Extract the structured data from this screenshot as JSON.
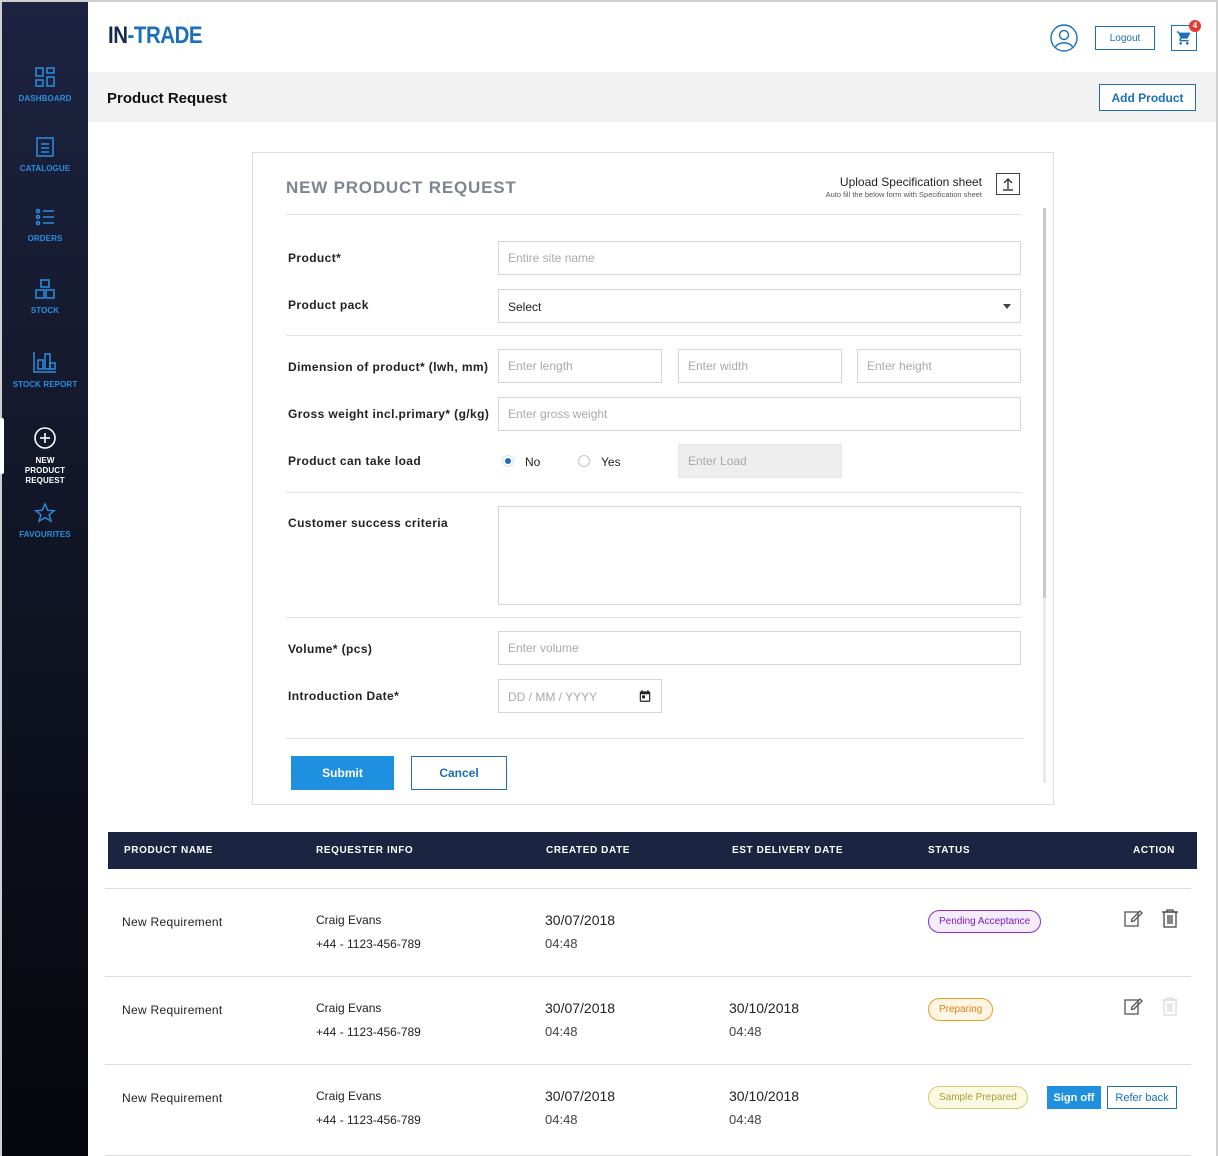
{
  "brand": {
    "logo_part1": "IN",
    "logo_part2": "-TRADE"
  },
  "sidebar": {
    "items": [
      {
        "label": "DASHBOARD",
        "icon": "dashboard-icon"
      },
      {
        "label": "CATALOGUE",
        "icon": "catalogue-icon"
      },
      {
        "label": "ORDERS",
        "icon": "orders-icon"
      },
      {
        "label": "STOCK",
        "icon": "stock-icon"
      },
      {
        "label": "STOCK REPORT",
        "icon": "stock-report-icon"
      },
      {
        "label": "NEW PRODUCT REQUEST",
        "icon": "plus-circle-icon",
        "active": true
      },
      {
        "label": "FAVOURITES",
        "icon": "star-icon"
      }
    ]
  },
  "header": {
    "logout_label": "Logout",
    "cart_count": "4"
  },
  "subheader": {
    "page_title": "Product Request",
    "add_product_label": "Add Product"
  },
  "form": {
    "title": "NEW PRODUCT REQUEST",
    "upload_label": "Upload Specification sheet",
    "upload_sub": "Auto fill the below form with Specification sheet",
    "product_label": "Product*",
    "product_placeholder": "Entire site name",
    "pack_label": "Product pack",
    "pack_value": "Select",
    "dimension_label": "Dimension of product* (lwh, mm)",
    "length_placeholder": "Enter length",
    "width_placeholder": "Enter width",
    "height_placeholder": "Enter height",
    "gross_label": "Gross weight incl.primary* (g/kg)",
    "gross_placeholder": "Enter gross weight",
    "load_label": "Product can take load",
    "load_no": "No",
    "load_yes": "Yes",
    "load_placeholder": "Enter Load",
    "criteria_label": "Customer success criteria",
    "volume_label": "Volume* (pcs)",
    "volume_placeholder": "Enter volume",
    "intro_label": "Introduction Date*",
    "intro_placeholder": "DD / MM / YYYY",
    "submit_label": "Submit",
    "cancel_label": "Cancel"
  },
  "table": {
    "headers": [
      "PRODUCT NAME",
      "REQUESTER INFO",
      "CREATED DATE",
      "EST DELIVERY DATE",
      "STATUS",
      "ACTION"
    ],
    "rows": [
      {
        "name": "New Requirement",
        "requester": "Craig Evans",
        "phone": "+44 - 1123-456-789",
        "created_date": "30/07/2018",
        "created_time": "04:48",
        "delivery_date": "",
        "delivery_time": "",
        "status": "Pending Acceptance"
      },
      {
        "name": "New Requirement",
        "requester": "Craig Evans",
        "phone": "+44 - 1123-456-789",
        "created_date": "30/07/2018",
        "created_time": "04:48",
        "delivery_date": "30/10/2018",
        "delivery_time": "04:48",
        "status": "Preparing"
      },
      {
        "name": "New Requirement",
        "requester": "Craig Evans",
        "phone": "+44 - 1123-456-789",
        "created_date": "30/07/2018",
        "created_time": "04:48",
        "delivery_date": "30/10/2018",
        "delivery_time": "04:48",
        "status": "Sample Prepared",
        "signoff_label": "Sign off",
        "referback_label": "Refer back"
      }
    ]
  },
  "colors": {
    "accent": "#1f8fe0",
    "brand_blue": "#1c6fb8",
    "nav_dark": "#1b2440"
  }
}
